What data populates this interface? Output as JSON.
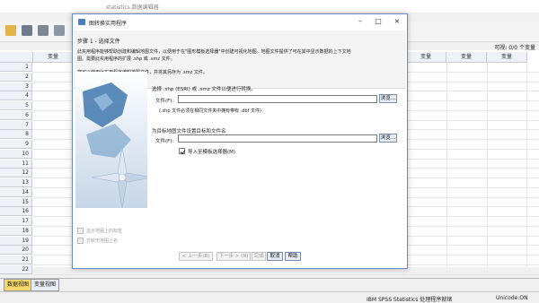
{
  "app": {
    "title": "statistics 数据编辑器",
    "visible_count": "可视: 0/0 个变量",
    "column_header": "变量",
    "row_numbers": [
      "1",
      "2",
      "3",
      "4",
      "5",
      "6",
      "7",
      "8",
      "9",
      "10",
      "11",
      "12",
      "13",
      "14",
      "15",
      "16",
      "17",
      "18",
      "19",
      "20",
      "21",
      "22"
    ],
    "tabs": {
      "data_view": "数据视图",
      "variable_view": "变量视图"
    },
    "status": {
      "processor": "IBM SPSS Statistics 处理程序就绪",
      "unicode": "Unicode:ON"
    }
  },
  "dialog": {
    "title": "图转换实用程序",
    "step_title": "步骤 1 - 选择文件",
    "intro_line1": "此实用程序能够帮助创建和编辑地图文件，以便用于在\"图形模板选择器\"中创建可视化地图。地图文件提供了可在其中显示数据的上下文地",
    "intro_line2": "图。需要此实用程序的扩展 .shp 或 .smz 文件。",
    "intro_line3": "您可以使用此实用程序编辑地图文件，并将其另存为 .smz 文件。",
    "section1_label": "选择 .shp (ESRI) 或 .smz 文件以便进行转换。",
    "file_label_1": "文件(F):",
    "file_value_1": "",
    "browse_1": "浏览...",
    "dbf_note": "(.shp 文件必须在相同文件夹中拥有带有 .dbf 文件)",
    "section2_label": "为目标地图文件设置目标和文件名",
    "file_label_2": "文件(F):",
    "file_value_2": "",
    "browse_2": "浏览...",
    "import_option": "导入至模板选择器(M)",
    "import_checked": true,
    "show_labels": "显示地图上的标签",
    "show_on_map": "方转无地图上名",
    "buttons": {
      "prev": "< 上一步(B)",
      "next": "下一步 > (N)",
      "finish": "完成",
      "cancel": "取消",
      "help": "帮助"
    }
  }
}
